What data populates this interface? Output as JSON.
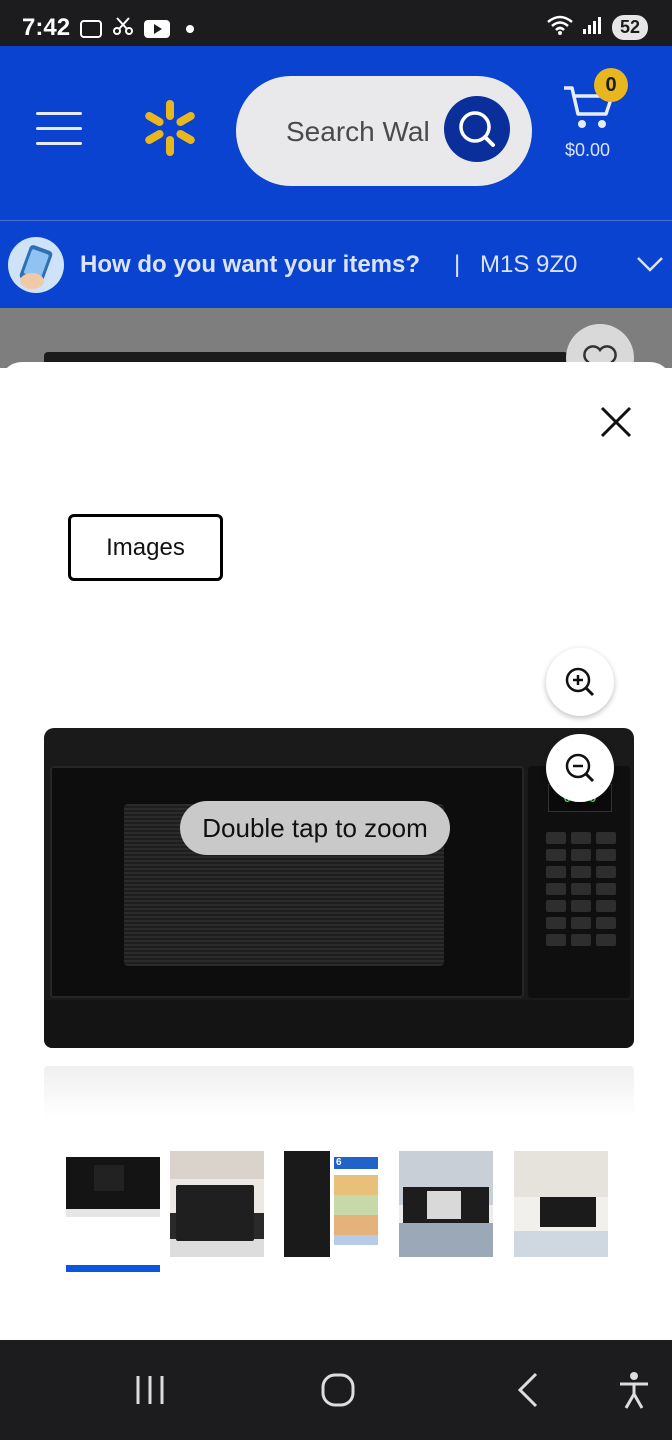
{
  "status_bar": {
    "time": "7:42",
    "battery": "52"
  },
  "header": {
    "search_placeholder": "Search Wal",
    "cart_count": "0",
    "cart_total": "$0.00",
    "brand_color": "#0a43cf",
    "accent_yellow": "#e8b61d"
  },
  "delivery": {
    "prompt": "How do you want your items?",
    "separator": "|",
    "postal_code": "M1S 9Z0"
  },
  "modal": {
    "images_tab_label": "Images",
    "zoom_hint": "Double tap to zoom",
    "microwave_display": "0:00",
    "thumbnails": [
      {
        "name": "thumb-front",
        "active": true
      },
      {
        "name": "thumb-kitchen-1",
        "active": false
      },
      {
        "name": "thumb-preset-menus",
        "active": false
      },
      {
        "name": "thumb-open-door",
        "active": false
      },
      {
        "name": "thumb-kitchen-2",
        "active": false
      }
    ],
    "thumb_badge_text": "6"
  },
  "icons": {
    "menu": "hamburger-menu-icon",
    "logo": "walmart-spark-icon",
    "search": "search-icon",
    "cart": "cart-icon",
    "chevron": "chevron-down-icon",
    "close": "close-icon",
    "zoom_in": "zoom-in-icon",
    "zoom_out": "zoom-out-icon",
    "heart": "heart-icon"
  }
}
